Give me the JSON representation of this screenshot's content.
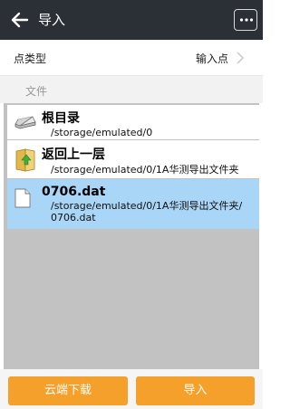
{
  "header": {
    "title": "导入",
    "back_icon": "arrow-left-icon",
    "more_icon": "more-horizontal-icon"
  },
  "point_type": {
    "label": "点类型",
    "value": "输入点"
  },
  "files_section": {
    "label": "文件"
  },
  "file_list": [
    {
      "name": "根目录",
      "path": "/storage/emulated/0",
      "icon": "drive-icon"
    },
    {
      "name": "返回上一层",
      "path": "/storage/emulated/0/1A华测导出文件夹",
      "icon": "folder-up-icon"
    },
    {
      "name": "0706.dat",
      "path": "/storage/emulated/0/1A华测导出文件夹/\n0706.dat",
      "icon": "file-icon",
      "selected": true
    }
  ],
  "buttons": {
    "cloud_download": "云端下载",
    "import": "导入"
  },
  "colors": {
    "header_bg": "#2b2f36",
    "accent_orange": "#f5a02a",
    "selected_bg": "#a9d5f6"
  }
}
